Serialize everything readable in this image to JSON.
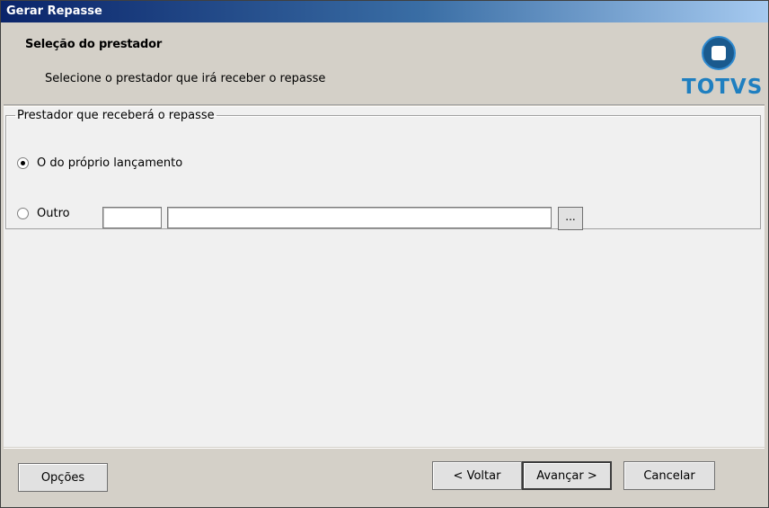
{
  "window": {
    "title": "Gerar Repasse"
  },
  "header": {
    "title": "Seleção do prestador",
    "subtitle": "Selecione o prestador que irá receber o repasse",
    "logo_text": "TOTVS"
  },
  "group": {
    "legend": "Prestador que receberá o repasse",
    "option_own": {
      "label": "O do próprio lançamento",
      "checked": true
    },
    "option_other": {
      "label": "Outro",
      "checked": false
    },
    "code_value": "",
    "name_value": "",
    "browse_label": "..."
  },
  "footer": {
    "options_label": "Opções",
    "back_label": "< Voltar",
    "next_label": "Avançar >",
    "cancel_label": "Cancelar"
  },
  "colors": {
    "brand": "#1f7fc0",
    "title_bar": "#0a246a"
  }
}
